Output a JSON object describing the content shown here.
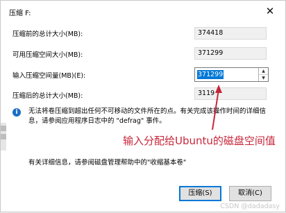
{
  "dialog": {
    "title": "压缩 F:",
    "close_glyph": "✕"
  },
  "rows": {
    "total_before_label": "压缩前的总计大小(MB):",
    "total_before_value": "374418",
    "available_label": "可用压缩空间大小(MB):",
    "available_value": "371299",
    "input_label": "输入压缩空间量(MB)(E):",
    "input_value": "371299",
    "total_after_label": "压缩后的总计大小(MB):",
    "total_after_value": "3119"
  },
  "spin": {
    "up_glyph": "▲",
    "down_glyph": "▼"
  },
  "info": {
    "icon_glyph": "i",
    "text": "无法将卷压缩到超出任何不可移动的文件所在的点。有关完成该操作时间的详细信息，请参阅应用程序日志中的 \"defrag\" 事件。"
  },
  "annotation": "输入分配给Ubuntu的磁盘空间值",
  "details_text": "有关详细信息，请参阅磁盘管理帮助中的\"收缩基本卷\"",
  "buttons": {
    "ok": "压缩(S)",
    "cancel": "取消(C)"
  },
  "watermark": "CSDN @dadadasy",
  "colors": {
    "annotation": "#c7253a",
    "selection": "#0078d7",
    "info_icon": "#1a6fc4"
  }
}
